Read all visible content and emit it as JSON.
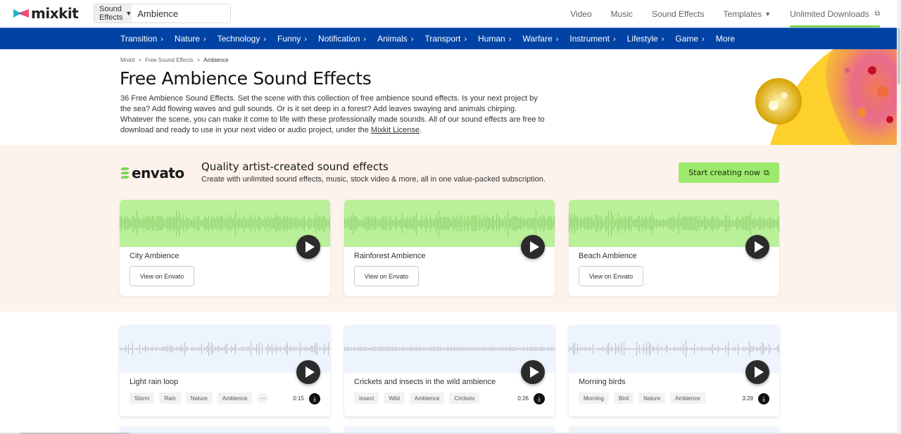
{
  "header": {
    "logo_text": "mixkit",
    "search_type": "Sound Effects",
    "search_value": "Ambience",
    "nav": [
      {
        "label": "Video"
      },
      {
        "label": "Music"
      },
      {
        "label": "Sound Effects"
      },
      {
        "label": "Templates",
        "dropdown": true
      },
      {
        "label": "Unlimited Downloads",
        "external": true
      }
    ]
  },
  "categories": [
    "Transition",
    "Nature",
    "Technology",
    "Funny",
    "Notification",
    "Animals",
    "Transport",
    "Human",
    "Warfare",
    "Instrument",
    "Lifestyle",
    "Game",
    "More"
  ],
  "breadcrumb": [
    "Mixkit",
    "Free Sound Effects",
    "Ambience"
  ],
  "hero": {
    "title": "Free Ambience Sound Effects",
    "description": "36 Free Ambience Sound Effects. Set the scene with this collection of free ambience sound effects. Is your next project by the sea? Add flowing waves and gull sounds. Or is it set deep in a forest? Add leaves swaying and animals chirping. Whatever the scene, you can make it come to life with these professionally made sounds. All of our sound effects are free to download and ready to use in your next video or audio project, under the ",
    "license_link": "Mixkit License",
    "description_end": "."
  },
  "promo": {
    "brand": "envato",
    "title": "Quality artist-created sound effects",
    "subtitle": "Create with unlimited sound effects, music, stock video & more, all in one value-packed subscription.",
    "cta_label": "Start creating now",
    "cards": [
      {
        "title": "City Ambience",
        "button": "View on Envato"
      },
      {
        "title": "Rainforest Ambience",
        "button": "View on Envato"
      },
      {
        "title": "Beach Ambience",
        "button": "View on Envato"
      }
    ]
  },
  "items": [
    {
      "title": "Light rain loop",
      "tags": [
        "Storm",
        "Rain",
        "Nature",
        "Ambience"
      ],
      "has_more": true,
      "more_label": "···",
      "duration": "0:15"
    },
    {
      "title": "Crickets and insects in the wild ambience",
      "tags": [
        "Insect",
        "Wild",
        "Ambience",
        "Crickets"
      ],
      "has_more": false,
      "duration": "0:26"
    },
    {
      "title": "Morning birds",
      "tags": [
        "Morning",
        "Bird",
        "Nature",
        "Ambience"
      ],
      "has_more": false,
      "duration": "3:29"
    }
  ],
  "colors": {
    "brand_blue": "#0043a4",
    "accent_green": "#9ce96b",
    "promo_bg": "#fdf3ec",
    "promo_wave_bg": "#b9f099",
    "item_wave_bg": "#eef4fd"
  }
}
